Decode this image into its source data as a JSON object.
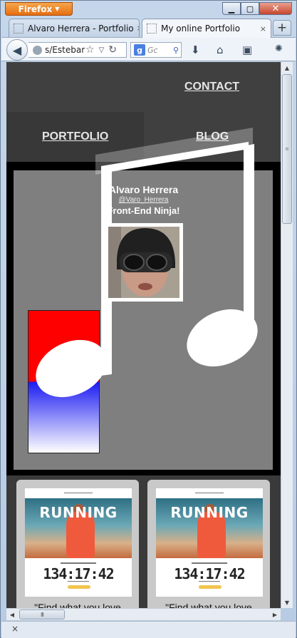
{
  "browser": {
    "app_button": "Firefox",
    "window_controls": {
      "minimize": "▁",
      "maximize": "▢",
      "close": "✕"
    },
    "tabs": [
      {
        "title": "Alvaro Herrera - Portfolio",
        "close": "×"
      },
      {
        "title": "My online Portfolio",
        "close": "×"
      }
    ],
    "new_tab": "+",
    "address": "s/Estebar",
    "search_placeholder": "Gc",
    "search_engine": "g"
  },
  "site": {
    "nav": {
      "contact": "CONTACT",
      "portfolio": "PORTFOLIO",
      "blog": "BLOG"
    },
    "profile": {
      "name": "Alvaro Herrera",
      "handle": "@Varo_Herrera",
      "tagline": "Front-End Ninja!"
    },
    "cards": [
      {
        "shot_title": "RUNNING",
        "shot_timer": "134:17:42",
        "quote": "\"Find what you love"
      },
      {
        "shot_title": "RUNNING",
        "shot_timer": "134:17:42",
        "quote": "\"Find what you love"
      }
    ]
  },
  "scroll": {
    "horizontal_grip": "III",
    "vertical_grip": "≡"
  },
  "status": {
    "close": "×"
  },
  "colors": {
    "firefox_orange": "#e66e12",
    "header_bg": "#404040",
    "hero_bg": "#7f7f7f",
    "note_fill": "#ffffff"
  },
  "icons": [
    "back-arrow-icon",
    "globe-icon",
    "bookmark-star-icon",
    "reload-icon",
    "google-icon",
    "search-icon",
    "download-icon",
    "home-icon",
    "bookmarks-menu-icon",
    "addon-icon"
  ]
}
